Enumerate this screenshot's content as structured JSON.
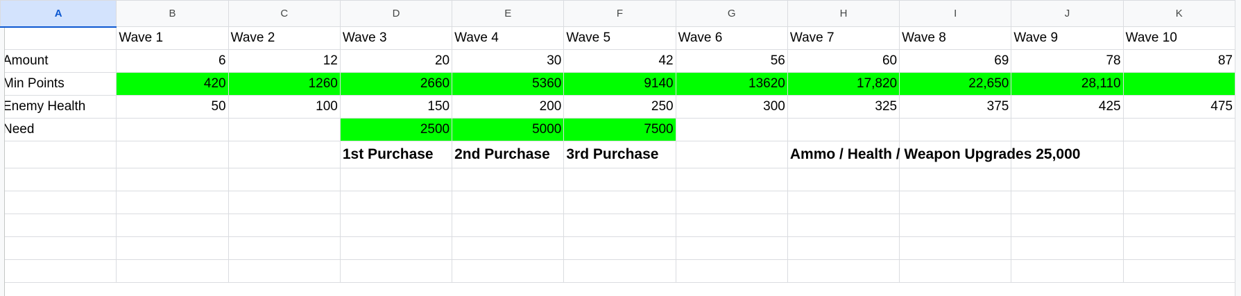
{
  "columns": [
    "A",
    "B",
    "C",
    "D",
    "E",
    "F",
    "G",
    "H",
    "I",
    "J",
    "K"
  ],
  "selected_column": "A",
  "rows": [
    {
      "cells": [
        "",
        "Wave 1",
        "Wave 2",
        "Wave 3",
        "Wave 4",
        "Wave 5",
        "Wave 6",
        "Wave 7",
        "Wave 8",
        "Wave 9",
        "Wave 10"
      ]
    },
    {
      "cells": [
        "Amount",
        "6",
        "12",
        "20",
        "30",
        "42",
        "56",
        "60",
        "69",
        "78",
        "87"
      ]
    },
    {
      "cells": [
        "Min Points",
        "420",
        "1260",
        "2660",
        "5360",
        "9140",
        "13620",
        "17,820",
        "22,650",
        "28,110",
        ""
      ]
    },
    {
      "cells": [
        "Enemy Health",
        "50",
        "100",
        "150",
        "200",
        "250",
        "300",
        "325",
        "375",
        "425",
        "475"
      ]
    },
    {
      "cells": [
        "Need",
        "",
        "",
        "2500",
        "5000",
        "7500",
        "",
        "",
        "",
        "",
        ""
      ]
    },
    {
      "cells": [
        "",
        "",
        "",
        "1st Purchase",
        "2nd Purchase",
        "3rd Purchase",
        "",
        "Ammo / Health / Weapon Upgrades  25,000",
        "",
        "",
        ""
      ]
    },
    {
      "cells": [
        "",
        "",
        "",
        "",
        "",
        "",
        "",
        "",
        "",
        "",
        ""
      ]
    },
    {
      "cells": [
        "",
        "",
        "",
        "",
        "",
        "",
        "",
        "",
        "",
        "",
        ""
      ]
    },
    {
      "cells": [
        "",
        "",
        "",
        "",
        "",
        "",
        "",
        "",
        "",
        "",
        ""
      ]
    },
    {
      "cells": [
        "",
        "",
        "",
        "",
        "",
        "",
        "",
        "",
        "",
        "",
        ""
      ]
    },
    {
      "cells": [
        "",
        "",
        "",
        "",
        "",
        "",
        "",
        "",
        "",
        "",
        ""
      ]
    }
  ],
  "colors": {
    "highlight_green": "#00ff00",
    "header_bg": "#f8f9fa",
    "selected_header_bg": "#d3e3fd",
    "grid_line": "#dadce0"
  }
}
